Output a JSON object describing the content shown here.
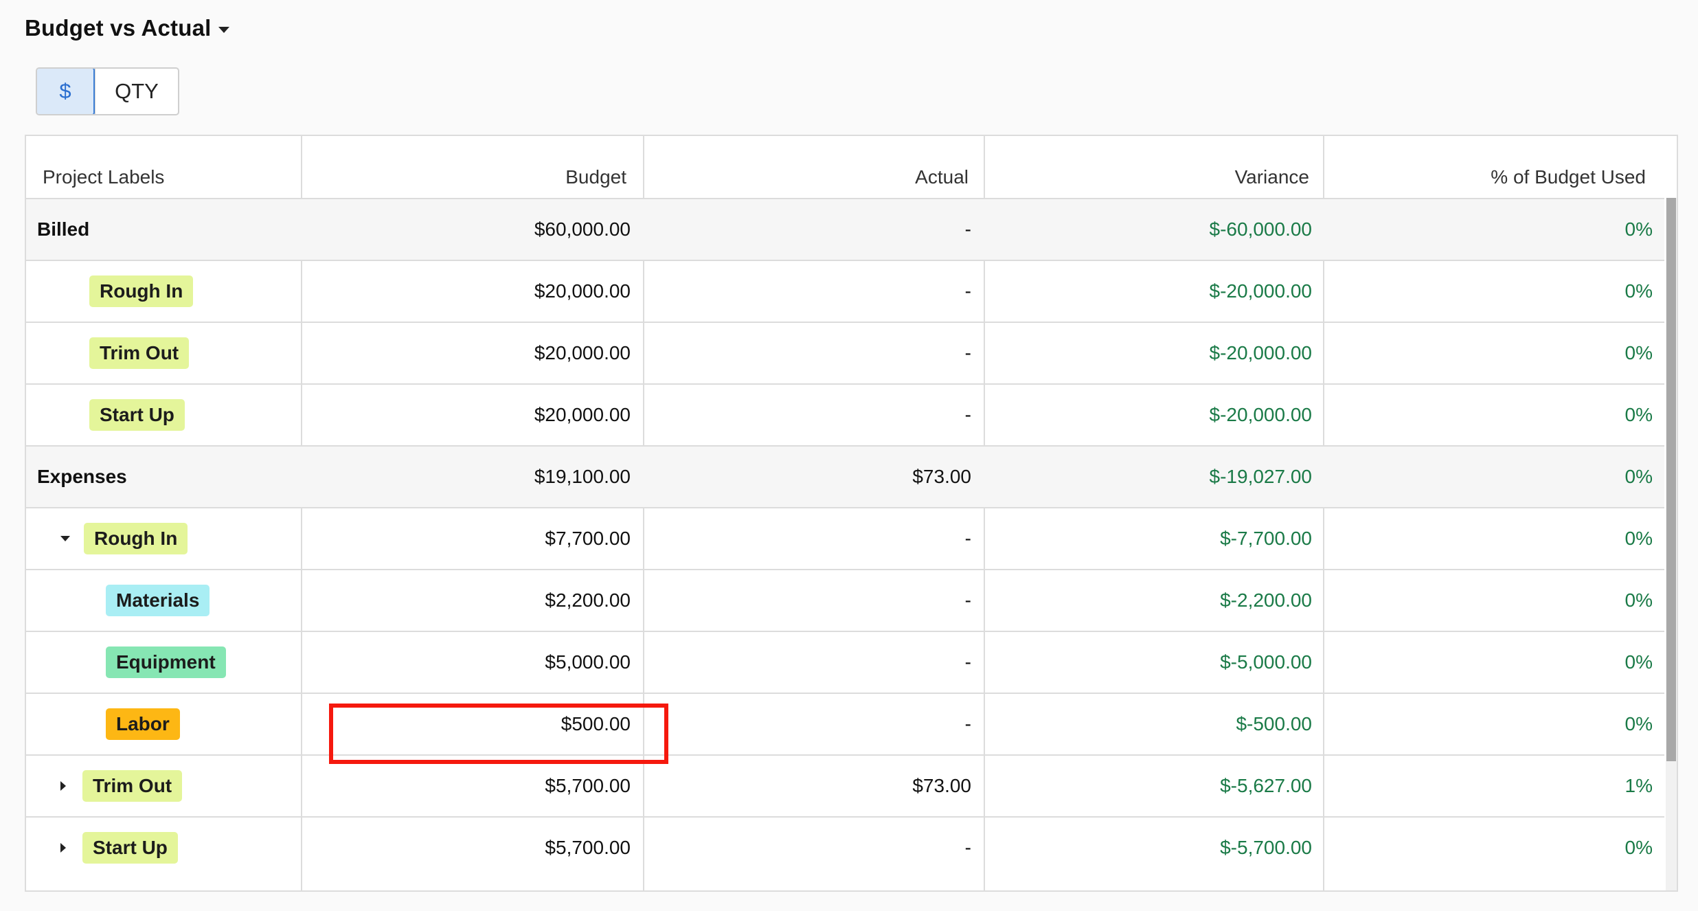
{
  "header": {
    "title": "Budget vs Actual"
  },
  "toggle": {
    "dollar_label": "$",
    "qty_label": "QTY"
  },
  "table": {
    "columns": [
      "Project Labels",
      "Budget",
      "Actual",
      "Variance",
      "% of Budget Used"
    ],
    "rows": [
      {
        "label": "Billed",
        "kind": "group",
        "budget": "$60,000.00",
        "actual": "-",
        "variance": "$-60,000.00",
        "pct": "0%"
      },
      {
        "label": "Rough In",
        "kind": "tag",
        "tag_color": "#e4f59a",
        "budget": "$20,000.00",
        "actual": "-",
        "variance": "$-20,000.00",
        "pct": "0%"
      },
      {
        "label": "Trim Out",
        "kind": "tag",
        "tag_color": "#e4f59a",
        "budget": "$20,000.00",
        "actual": "-",
        "variance": "$-20,000.00",
        "pct": "0%"
      },
      {
        "label": "Start Up",
        "kind": "tag",
        "tag_color": "#e4f59a",
        "budget": "$20,000.00",
        "actual": "-",
        "variance": "$-20,000.00",
        "pct": "0%"
      },
      {
        "label": "Expenses",
        "kind": "group",
        "budget": "$19,100.00",
        "actual": "$73.00",
        "variance": "$-19,027.00",
        "pct": "0%"
      },
      {
        "label": "Rough In",
        "kind": "tag-expanded",
        "tag_color": "#e4f59a",
        "budget": "$7,700.00",
        "actual": "-",
        "variance": "$-7,700.00",
        "pct": "0%"
      },
      {
        "label": "Materials",
        "kind": "subtag",
        "tag_color": "#a9eef4",
        "budget": "$2,200.00",
        "actual": "-",
        "variance": "$-2,200.00",
        "pct": "0%"
      },
      {
        "label": "Equipment",
        "kind": "subtag",
        "tag_color": "#86e6b3",
        "budget": "$5,000.00",
        "actual": "-",
        "variance": "$-5,000.00",
        "pct": "0%"
      },
      {
        "label": "Labor",
        "kind": "subtag",
        "tag_color": "#fdb714",
        "budget": "$500.00",
        "actual": "-",
        "variance": "$-500.00",
        "pct": "0%"
      },
      {
        "label": "Trim Out",
        "kind": "tag-collapsed",
        "tag_color": "#e4f59a",
        "budget": "$5,700.00",
        "actual": "$73.00",
        "variance": "$-5,627.00",
        "pct": "1%"
      },
      {
        "label": "Start Up",
        "kind": "tag-collapsed",
        "tag_color": "#e4f59a",
        "budget": "$5,700.00",
        "actual": "-",
        "variance": "$-5,700.00",
        "pct": "0%"
      }
    ]
  },
  "colors": {
    "variance_green": "#1a7a47",
    "highlight_red": "#f5190e",
    "toggle_active_bg": "#dbe9f9",
    "toggle_active_text": "#2a6ecf"
  }
}
